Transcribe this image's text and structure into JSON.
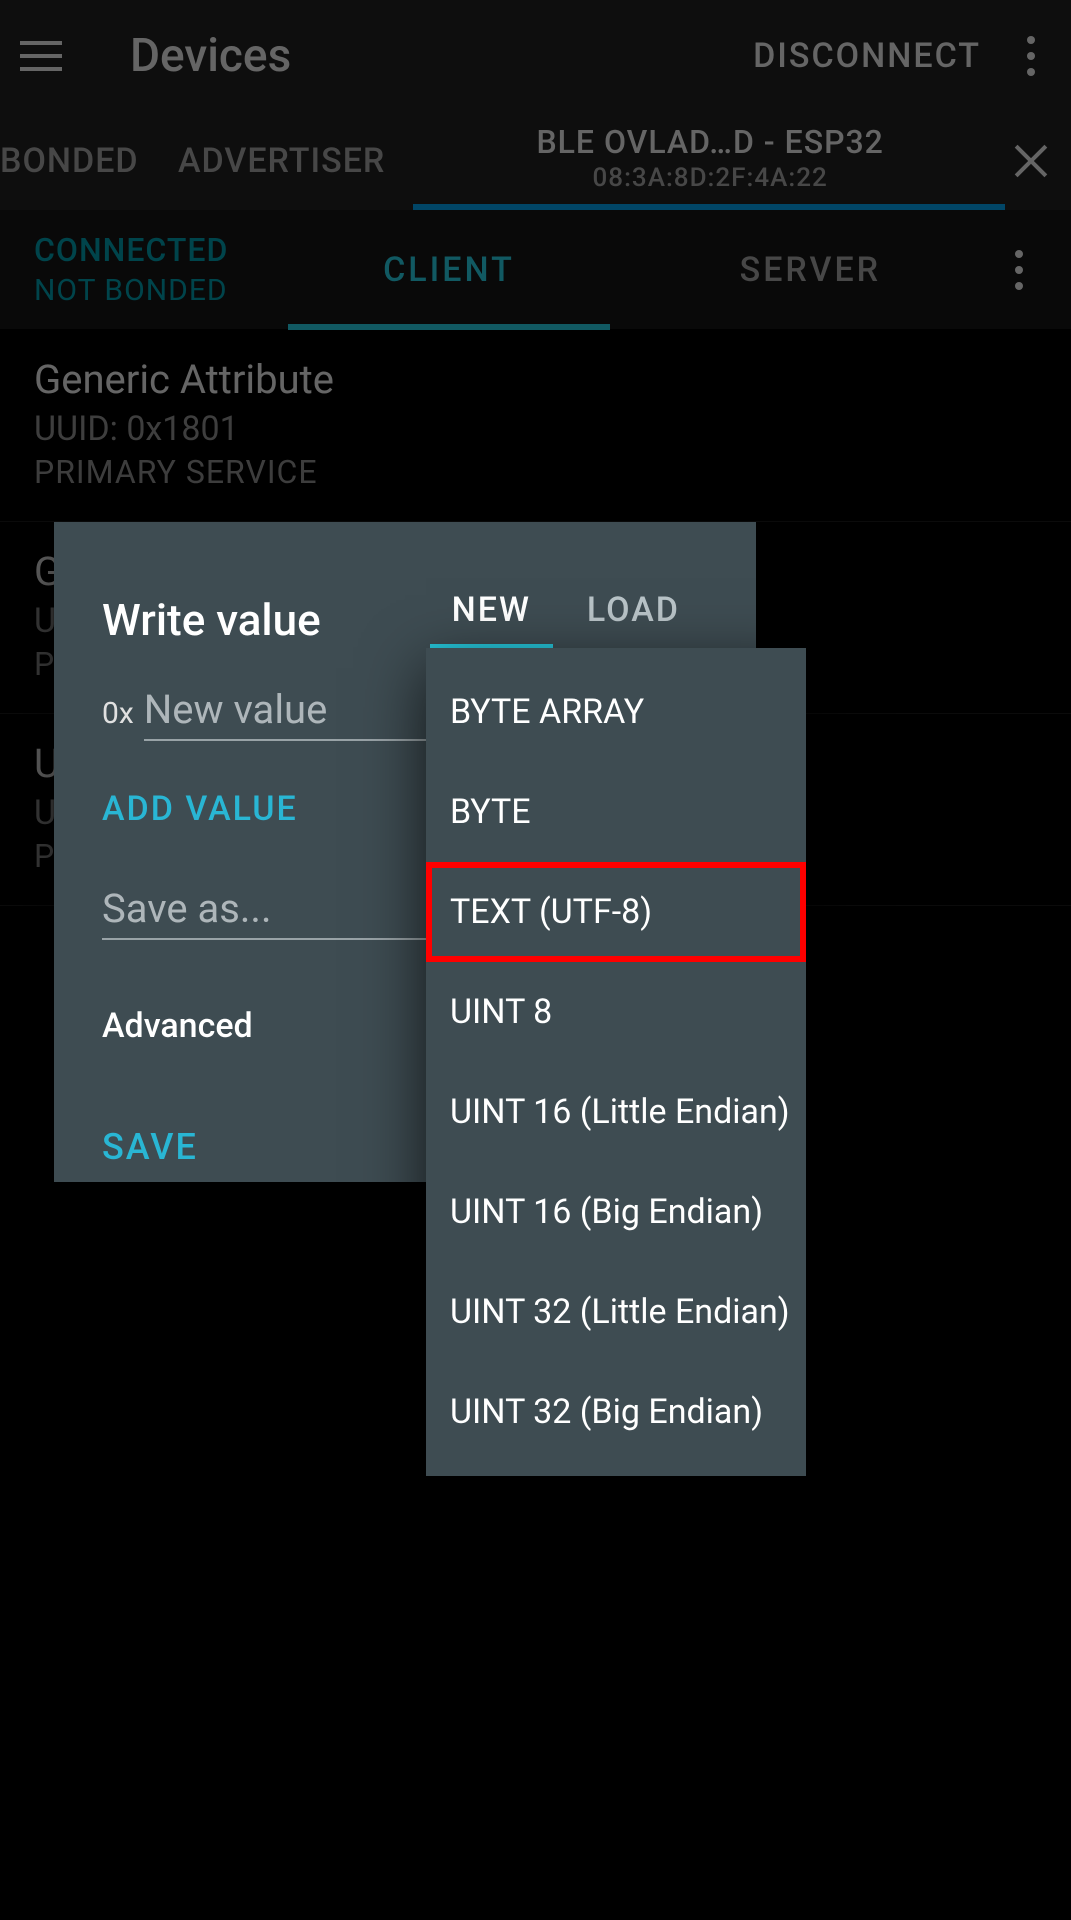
{
  "appbar": {
    "title": "Devices",
    "disconnect": "DISCONNECT"
  },
  "toptabs": {
    "bonded": "BONDED",
    "advertiser": "ADVERTISER",
    "devname": "BLE OVLAD…D - ESP32",
    "devmac": "08:3A:8D:2F:4A:22"
  },
  "connbar": {
    "connected": "CONNECTED",
    "notbonded": "NOT BONDED",
    "client": "CLIENT",
    "server": "SERVER"
  },
  "services": [
    {
      "name": "Generic Attribute",
      "uuid": "UUID: 0x1801",
      "type": "PRIMARY SERVICE"
    },
    {
      "name": "Generic Access",
      "uuid": "U",
      "type": "P"
    },
    {
      "name": "U",
      "uuid": "U",
      "type": "P"
    }
  ],
  "dialog": {
    "title": "Write value",
    "tab_new": "NEW",
    "tab_load": "LOAD",
    "prefix": "0x",
    "value_placeholder": "New value",
    "add_value": "ADD VALUE",
    "saveas_placeholder": "Save as...",
    "advanced": "Advanced",
    "save": "SAVE"
  },
  "dropdown": {
    "items": [
      "BYTE ARRAY",
      "BYTE",
      "TEXT (UTF-8)",
      "UINT 8",
      "UINT 16 (Little Endian)",
      "UINT 16 (Big Endian)",
      "UINT 32 (Little Endian)",
      "UINT 32 (Big Endian)"
    ],
    "highlighted_index": 2
  }
}
